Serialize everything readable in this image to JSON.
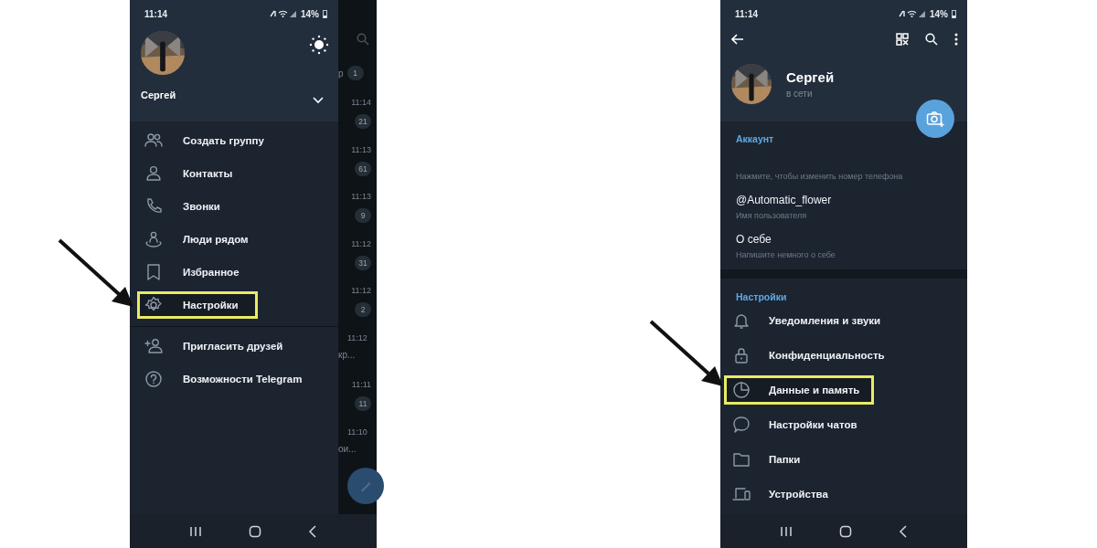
{
  "left_phone": {
    "status_bar": {
      "time": "11:14",
      "battery": "14%"
    },
    "drawer": {
      "name": "Сергей",
      "sections": [
        [
          {
            "label": "Создать группу",
            "highlighted": false
          },
          {
            "label": "Контакты",
            "highlighted": false
          },
          {
            "label": "Звонки",
            "highlighted": false
          },
          {
            "label": "Люди рядом",
            "highlighted": false
          },
          {
            "label": "Избранное",
            "highlighted": false
          },
          {
            "label": "Настройки",
            "highlighted": true
          }
        ],
        [
          {
            "label": "Пригласить друзей",
            "highlighted": false
          },
          {
            "label": "Возможности Telegram",
            "highlighted": false
          }
        ]
      ]
    },
    "chat_list_behind": {
      "top": {
        "snippet": "р",
        "badge": "1"
      },
      "rows": [
        {
          "time": "11:14",
          "badge": "21"
        },
        {
          "time": "11:13",
          "badge": "61"
        },
        {
          "time": "11:13",
          "badge": "9"
        },
        {
          "time": "11:12",
          "badge": "31"
        },
        {
          "time": "11:12",
          "badge": "2"
        },
        {
          "time": "11:12",
          "snippet": "кр..."
        },
        {
          "time": "11:11",
          "badge": "11"
        },
        {
          "time": "11:10",
          "snippet": "ои..."
        }
      ]
    }
  },
  "right_phone": {
    "status_bar": {
      "time": "11:14",
      "battery": "14%"
    },
    "profile": {
      "name": "Сергей",
      "status": "в сети"
    },
    "account": {
      "title": "Аккаунт",
      "phone_hint": "Нажмите, чтобы изменить номер телефона",
      "fields": [
        {
          "value": "@Automatic_flower",
          "hint": "Имя пользователя"
        },
        {
          "value": "О себе",
          "hint": "Напишите немного о себе"
        }
      ]
    },
    "settings": {
      "title": "Настройки",
      "items": [
        {
          "label": "Уведомления и звуки",
          "highlighted": false
        },
        {
          "label": "Конфиденциальность",
          "highlighted": false
        },
        {
          "label": "Данные и память",
          "highlighted": true
        },
        {
          "label": "Настройки чатов",
          "highlighted": false
        },
        {
          "label": "Папки",
          "highlighted": false
        },
        {
          "label": "Устройства",
          "highlighted": false
        }
      ]
    }
  }
}
